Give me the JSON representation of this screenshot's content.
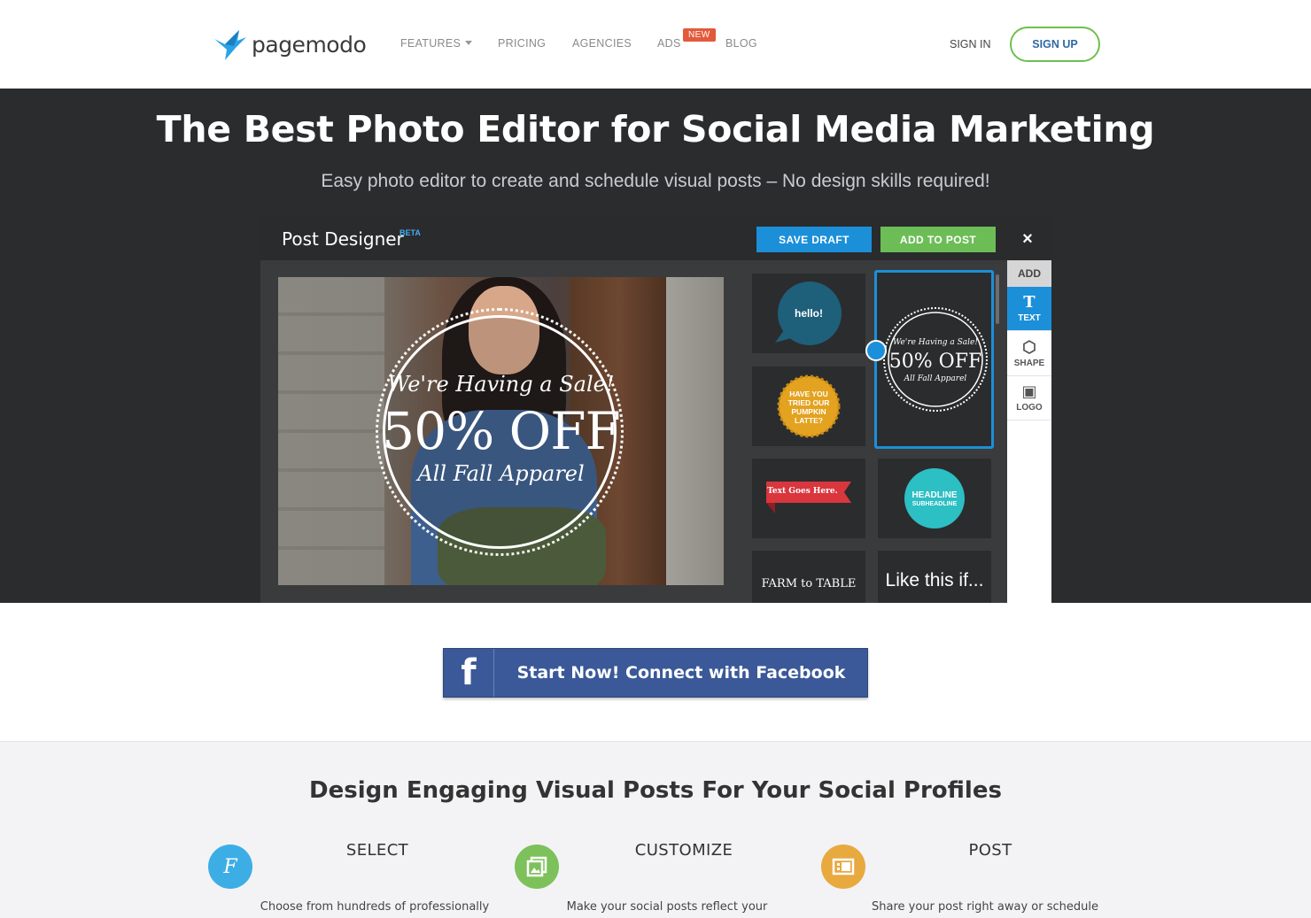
{
  "header": {
    "logo_text": "pagemodo",
    "nav": {
      "features": "FEATURES",
      "pricing": "PRICING",
      "agencies": "AGENCIES",
      "ads": "ADS",
      "ads_badge": "NEW",
      "blog": "BLOG"
    },
    "sign_in": "SIGN IN",
    "sign_up": "SIGN UP"
  },
  "hero": {
    "title": "The Best Photo Editor for Social Media Marketing",
    "subtitle": "Easy photo editor to create and schedule visual posts – No design skills required!"
  },
  "designer": {
    "title": "Post Designer",
    "beta": "BETA",
    "save_draft": "SAVE DRAFT",
    "add_to_post": "ADD TO POST",
    "close": "×",
    "canvas": {
      "line1": "We're Having a Sale!",
      "line2": "50% OFF",
      "line3": "All Fall Apparel"
    },
    "tiles": {
      "hello": "hello!",
      "pumpkin": "HAVE YOU TRIED OUR PUMPKIN LATTE?",
      "ribbon": "Text Goes Here.",
      "headline": "HEADLINE",
      "subheadline": "SUBHEADLINE",
      "farm": "FARM to TABLE",
      "likethis": "Like this if...",
      "sel_line1": "We're Having a Sale!",
      "sel_line2": "50% OFF",
      "sel_line3": "All Fall Apparel"
    },
    "side_panel": {
      "header": "ADD",
      "tools": [
        {
          "label": "TEXT",
          "icon": "text-icon"
        },
        {
          "label": "SHAPE",
          "icon": "cube-icon"
        },
        {
          "label": "LOGO",
          "icon": "image-icon"
        }
      ]
    }
  },
  "cta": {
    "facebook_icon": "f",
    "facebook_label": "Start Now! Connect with Facebook"
  },
  "features": {
    "title": "Design Engaging Visual Posts For Your Social Profiles",
    "items": [
      {
        "title": "SELECT",
        "desc": "Choose from hundreds of professionally",
        "color": "#3daee5",
        "icon": "font-icon"
      },
      {
        "title": "CUSTOMIZE",
        "desc": "Make your social posts reflect your",
        "color": "#7cc15a",
        "icon": "gallery-icon"
      },
      {
        "title": "POST",
        "desc": "Share your post right away or schedule",
        "color": "#e8a93f",
        "icon": "post-icon"
      }
    ]
  },
  "colors": {
    "brand_blue": "#1c8fd9",
    "brand_green": "#6dbd57",
    "facebook": "#3b5998",
    "hero_bg": "#2b2c2e"
  }
}
